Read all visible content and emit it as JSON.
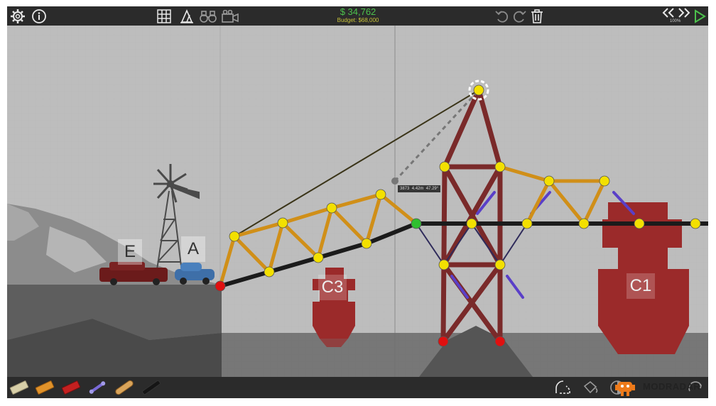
{
  "hud": {
    "money": "$ 34,762",
    "budget": "Budget: $68,000",
    "speed": "100%"
  },
  "icons": {
    "settings": "gear-icon",
    "info": "info-icon",
    "grid": "grid-icon",
    "stress": "stress-meter-icon",
    "binoculars": "binoculars-icon",
    "camera": "camera-icon",
    "undo": "undo-icon",
    "redo": "redo-icon",
    "delete": "trash-icon",
    "rewind": "rewind-icon",
    "forward": "fast-forward-icon",
    "play": "play-icon"
  },
  "labels": {
    "vehicle_e": "E",
    "vehicle_a": "A",
    "boat_c3": "C3",
    "boat_c1": "C1"
  },
  "measure": {
    "cost": "3873",
    "length": "4.42m",
    "angle": "47.29°"
  },
  "materials": [
    "road",
    "wood",
    "steel",
    "cable",
    "rope",
    "hydraulics"
  ],
  "bottom_tools": [
    "split-joint-icon",
    "paint-bucket-icon",
    "mirror-icon",
    "shuffle-icon"
  ],
  "watermark": "MODRADAR",
  "colors": {
    "wood": "#d08f18",
    "steel": "#7a2a2a",
    "road": "#1b1b1b",
    "cable": "#2e2a5a",
    "joint": "#f3e000",
    "anchor": "#e01010",
    "selected_joint": "#2fbf2f",
    "boat": "#9b2a2a",
    "money": "#4cc14c"
  }
}
